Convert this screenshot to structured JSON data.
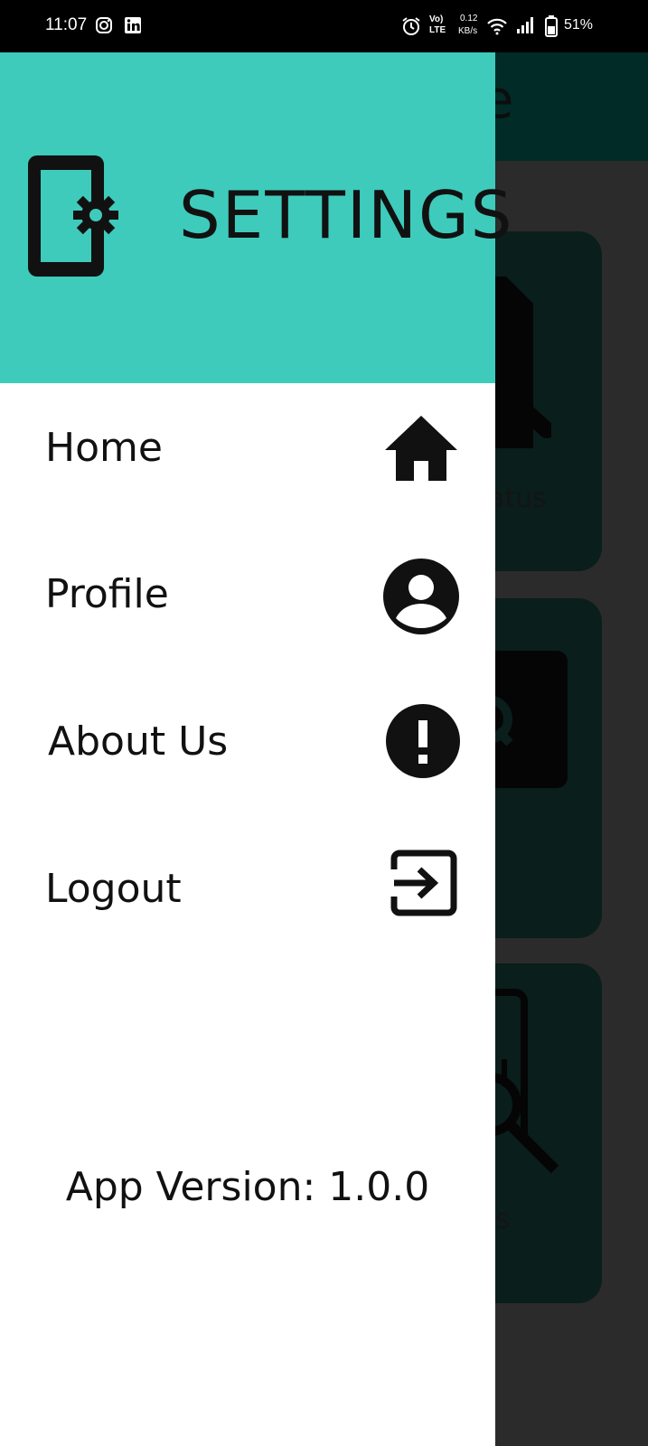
{
  "status_bar": {
    "time": "11:07",
    "data_speed_value": "0.12",
    "data_speed_unit": "KB/s",
    "battery": "51%",
    "volte_top": "Vo)",
    "volte_bottom": "LTE",
    "icons": [
      "instagram-icon",
      "linkedin-icon",
      "alarm-icon",
      "volte-icon",
      "wifi-icon",
      "signal-icon",
      "battery-icon"
    ]
  },
  "background_app": {
    "title_fragment": "nce",
    "cards": [
      {
        "label_fragment": "atus",
        "icon": "document-search-icon"
      },
      {
        "label_fragment": "",
        "icon": "quiz-icon"
      },
      {
        "label_fragment": "is",
        "icon": "analysis-icon"
      }
    ]
  },
  "drawer": {
    "header": {
      "title": "SETTINGS",
      "icon": "phone-settings-icon",
      "color": "#3ecbbb"
    },
    "menu": [
      {
        "label": "Home",
        "icon": "home-icon"
      },
      {
        "label": "Profile",
        "icon": "account-circle-icon"
      },
      {
        "label": "About Us",
        "icon": "info-exclamation-icon"
      },
      {
        "label": "Logout",
        "icon": "logout-icon"
      }
    ],
    "app_version": "App Version: 1.0.0"
  }
}
